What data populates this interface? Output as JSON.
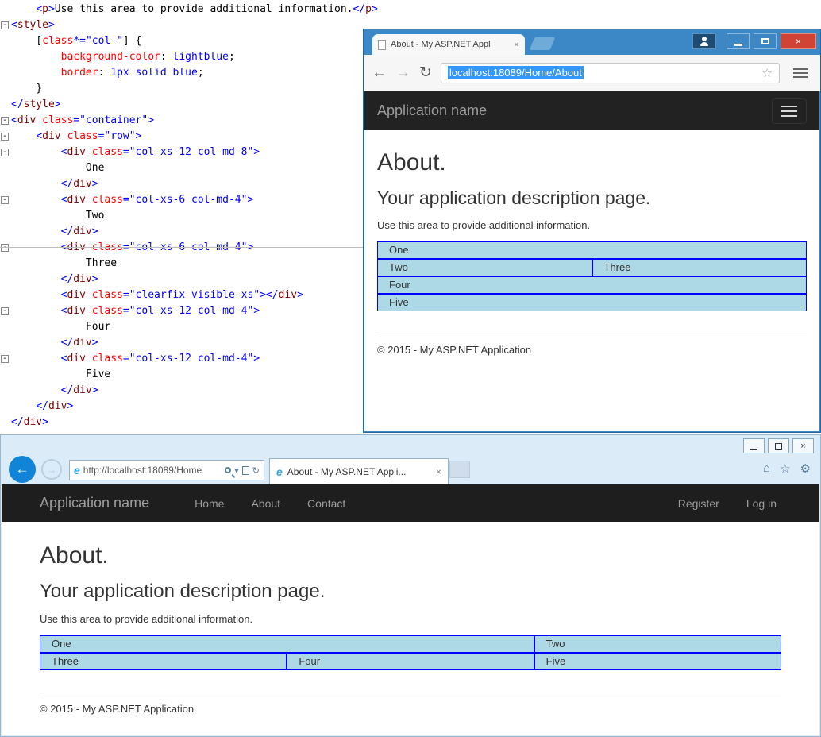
{
  "code_editor": {
    "lines": [
      {
        "fold": false,
        "tokens": [
          [
            "k",
            "    "
          ],
          [
            "b",
            "<"
          ],
          [
            "m",
            "p"
          ],
          [
            "b",
            ">"
          ],
          [
            "k",
            "Use this area to provide additional information."
          ],
          [
            "b",
            "</"
          ],
          [
            "m",
            "p"
          ],
          [
            "b",
            ">"
          ]
        ]
      },
      {
        "fold": true,
        "tokens": [
          [
            "b",
            "<"
          ],
          [
            "m",
            "style"
          ],
          [
            "b",
            ">"
          ]
        ]
      },
      {
        "fold": false,
        "tokens": [
          [
            "k",
            "    ["
          ],
          [
            "r",
            "class"
          ],
          [
            "b",
            "*="
          ],
          [
            "b",
            "\"col-\""
          ],
          [
            "k",
            "] {"
          ]
        ]
      },
      {
        "fold": false,
        "tokens": [
          [
            "k",
            "        "
          ],
          [
            "r",
            "background-color"
          ],
          [
            "k",
            ": "
          ],
          [
            "b",
            "lightblue"
          ],
          [
            "k",
            ";"
          ]
        ]
      },
      {
        "fold": false,
        "tokens": [
          [
            "k",
            "        "
          ],
          [
            "r",
            "border"
          ],
          [
            "k",
            ": "
          ],
          [
            "b",
            "1px solid blue"
          ],
          [
            "k",
            ";"
          ]
        ]
      },
      {
        "fold": false,
        "tokens": [
          [
            "k",
            "    }"
          ]
        ]
      },
      {
        "fold": false,
        "tokens": [
          [
            "b",
            "</"
          ],
          [
            "m",
            "style"
          ],
          [
            "b",
            ">"
          ]
        ]
      },
      {
        "fold": true,
        "tokens": [
          [
            "b",
            "<"
          ],
          [
            "m",
            "div"
          ],
          [
            "k",
            " "
          ],
          [
            "r",
            "class"
          ],
          [
            "b",
            "=\"container\">"
          ]
        ]
      },
      {
        "fold": true,
        "tokens": [
          [
            "k",
            "    "
          ],
          [
            "b",
            "<"
          ],
          [
            "m",
            "div"
          ],
          [
            "k",
            " "
          ],
          [
            "r",
            "class"
          ],
          [
            "b",
            "=\"row\">"
          ]
        ]
      },
      {
        "fold": true,
        "tokens": [
          [
            "k",
            "        "
          ],
          [
            "b",
            "<"
          ],
          [
            "m",
            "div"
          ],
          [
            "k",
            " "
          ],
          [
            "r",
            "class"
          ],
          [
            "b",
            "=\"col-xs-12 col-md-8\">"
          ]
        ]
      },
      {
        "fold": false,
        "tokens": [
          [
            "k",
            "            One"
          ]
        ]
      },
      {
        "fold": false,
        "tokens": [
          [
            "k",
            "        "
          ],
          [
            "b",
            "</"
          ],
          [
            "m",
            "div"
          ],
          [
            "b",
            ">"
          ]
        ]
      },
      {
        "fold": true,
        "tokens": [
          [
            "k",
            "        "
          ],
          [
            "b",
            "<"
          ],
          [
            "m",
            "div"
          ],
          [
            "k",
            " "
          ],
          [
            "r",
            "class"
          ],
          [
            "b",
            "=\"col-xs-6 col-md-4\">"
          ]
        ]
      },
      {
        "fold": false,
        "tokens": [
          [
            "k",
            "            Two"
          ]
        ]
      },
      {
        "fold": false,
        "tokens": [
          [
            "k",
            "        "
          ],
          [
            "b",
            "</"
          ],
          [
            "m",
            "div"
          ],
          [
            "b",
            ">"
          ]
        ]
      },
      {
        "fold": true,
        "tokens": [
          [
            "k",
            "        "
          ],
          [
            "b",
            "<"
          ],
          [
            "m",
            "div"
          ],
          [
            "k",
            " "
          ],
          [
            "r",
            "class"
          ],
          [
            "b",
            "=\"col-xs-6 col-md-4\">"
          ]
        ]
      },
      {
        "fold": false,
        "tokens": [
          [
            "k",
            "            Three"
          ]
        ]
      },
      {
        "fold": false,
        "tokens": [
          [
            "k",
            "        "
          ],
          [
            "b",
            "</"
          ],
          [
            "m",
            "div"
          ],
          [
            "b",
            ">"
          ]
        ]
      },
      {
        "fold": false,
        "tokens": [
          [
            "k",
            "        "
          ],
          [
            "b",
            "<"
          ],
          [
            "m",
            "div"
          ],
          [
            "k",
            " "
          ],
          [
            "r",
            "class"
          ],
          [
            "b",
            "=\"clearfix visible-xs\">"
          ],
          [
            "b",
            "</"
          ],
          [
            "m",
            "div"
          ],
          [
            "b",
            ">"
          ]
        ]
      },
      {
        "fold": true,
        "tokens": [
          [
            "k",
            "        "
          ],
          [
            "b",
            "<"
          ],
          [
            "m",
            "div"
          ],
          [
            "k",
            " "
          ],
          [
            "r",
            "class"
          ],
          [
            "b",
            "=\"col-xs-12 col-md-4\">"
          ]
        ]
      },
      {
        "fold": false,
        "tokens": [
          [
            "k",
            "            Four"
          ]
        ]
      },
      {
        "fold": false,
        "tokens": [
          [
            "k",
            "        "
          ],
          [
            "b",
            "</"
          ],
          [
            "m",
            "div"
          ],
          [
            "b",
            ">"
          ]
        ]
      },
      {
        "fold": true,
        "tokens": [
          [
            "k",
            "        "
          ],
          [
            "b",
            "<"
          ],
          [
            "m",
            "div"
          ],
          [
            "k",
            " "
          ],
          [
            "r",
            "class"
          ],
          [
            "b",
            "=\"col-xs-12 col-md-4\">"
          ]
        ]
      },
      {
        "fold": false,
        "tokens": [
          [
            "k",
            "            Five"
          ]
        ]
      },
      {
        "fold": false,
        "tokens": [
          [
            "k",
            "        "
          ],
          [
            "b",
            "</"
          ],
          [
            "m",
            "div"
          ],
          [
            "b",
            ">"
          ]
        ]
      },
      {
        "fold": false,
        "tokens": [
          [
            "k",
            "    "
          ],
          [
            "b",
            "</"
          ],
          [
            "m",
            "div"
          ],
          [
            "b",
            ">"
          ]
        ]
      },
      {
        "fold": false,
        "tokens": [
          [
            "b",
            "</"
          ],
          [
            "m",
            "div"
          ],
          [
            "b",
            ">"
          ]
        ]
      }
    ]
  },
  "chrome": {
    "tab_title": "About - My ASP.NET Appl",
    "url": "localhost:18089/Home/About",
    "page": {
      "brand": "Application name",
      "heading": "About.",
      "subheading": "Your application description page.",
      "description": "Use this area to provide additional information.",
      "grid_rows": [
        [
          "One"
        ],
        [
          "Two",
          "Three"
        ],
        [
          "Four"
        ],
        [
          "Five"
        ]
      ],
      "footer": "© 2015 - My ASP.NET Application"
    }
  },
  "ie": {
    "address": "http://localhost:18089/Home",
    "tab_title": "About - My ASP.NET Appli...",
    "page": {
      "brand": "Application name",
      "nav": [
        "Home",
        "About",
        "Contact"
      ],
      "nav_right": [
        "Register",
        "Log in"
      ],
      "heading": "About.",
      "subheading": "Your application description page.",
      "description": "Use this area to provide additional information.",
      "grid_rows": [
        [
          {
            "label": "One",
            "span": 8
          },
          {
            "label": "Two",
            "span": 4
          }
        ],
        [
          {
            "label": "Three",
            "span": 4
          },
          {
            "label": "Four",
            "span": 4
          },
          {
            "label": "Five",
            "span": 4
          }
        ]
      ],
      "footer": "© 2015 - My ASP.NET Application"
    }
  },
  "icons": {
    "back_arrow": "←",
    "forward_arrow": "→",
    "refresh": "↻",
    "star": "☆",
    "close": "×",
    "home": "⌂",
    "gear": "⚙",
    "caret_down": "▾",
    "ie_logo": "e",
    "fold_collapse": "-"
  },
  "colors": {
    "grid_bg": "#ADD8E6",
    "grid_border": "#0000FF",
    "navbar_bg": "#222222",
    "chrome_frame": "#3C87C5",
    "selection": "#3297FD"
  }
}
